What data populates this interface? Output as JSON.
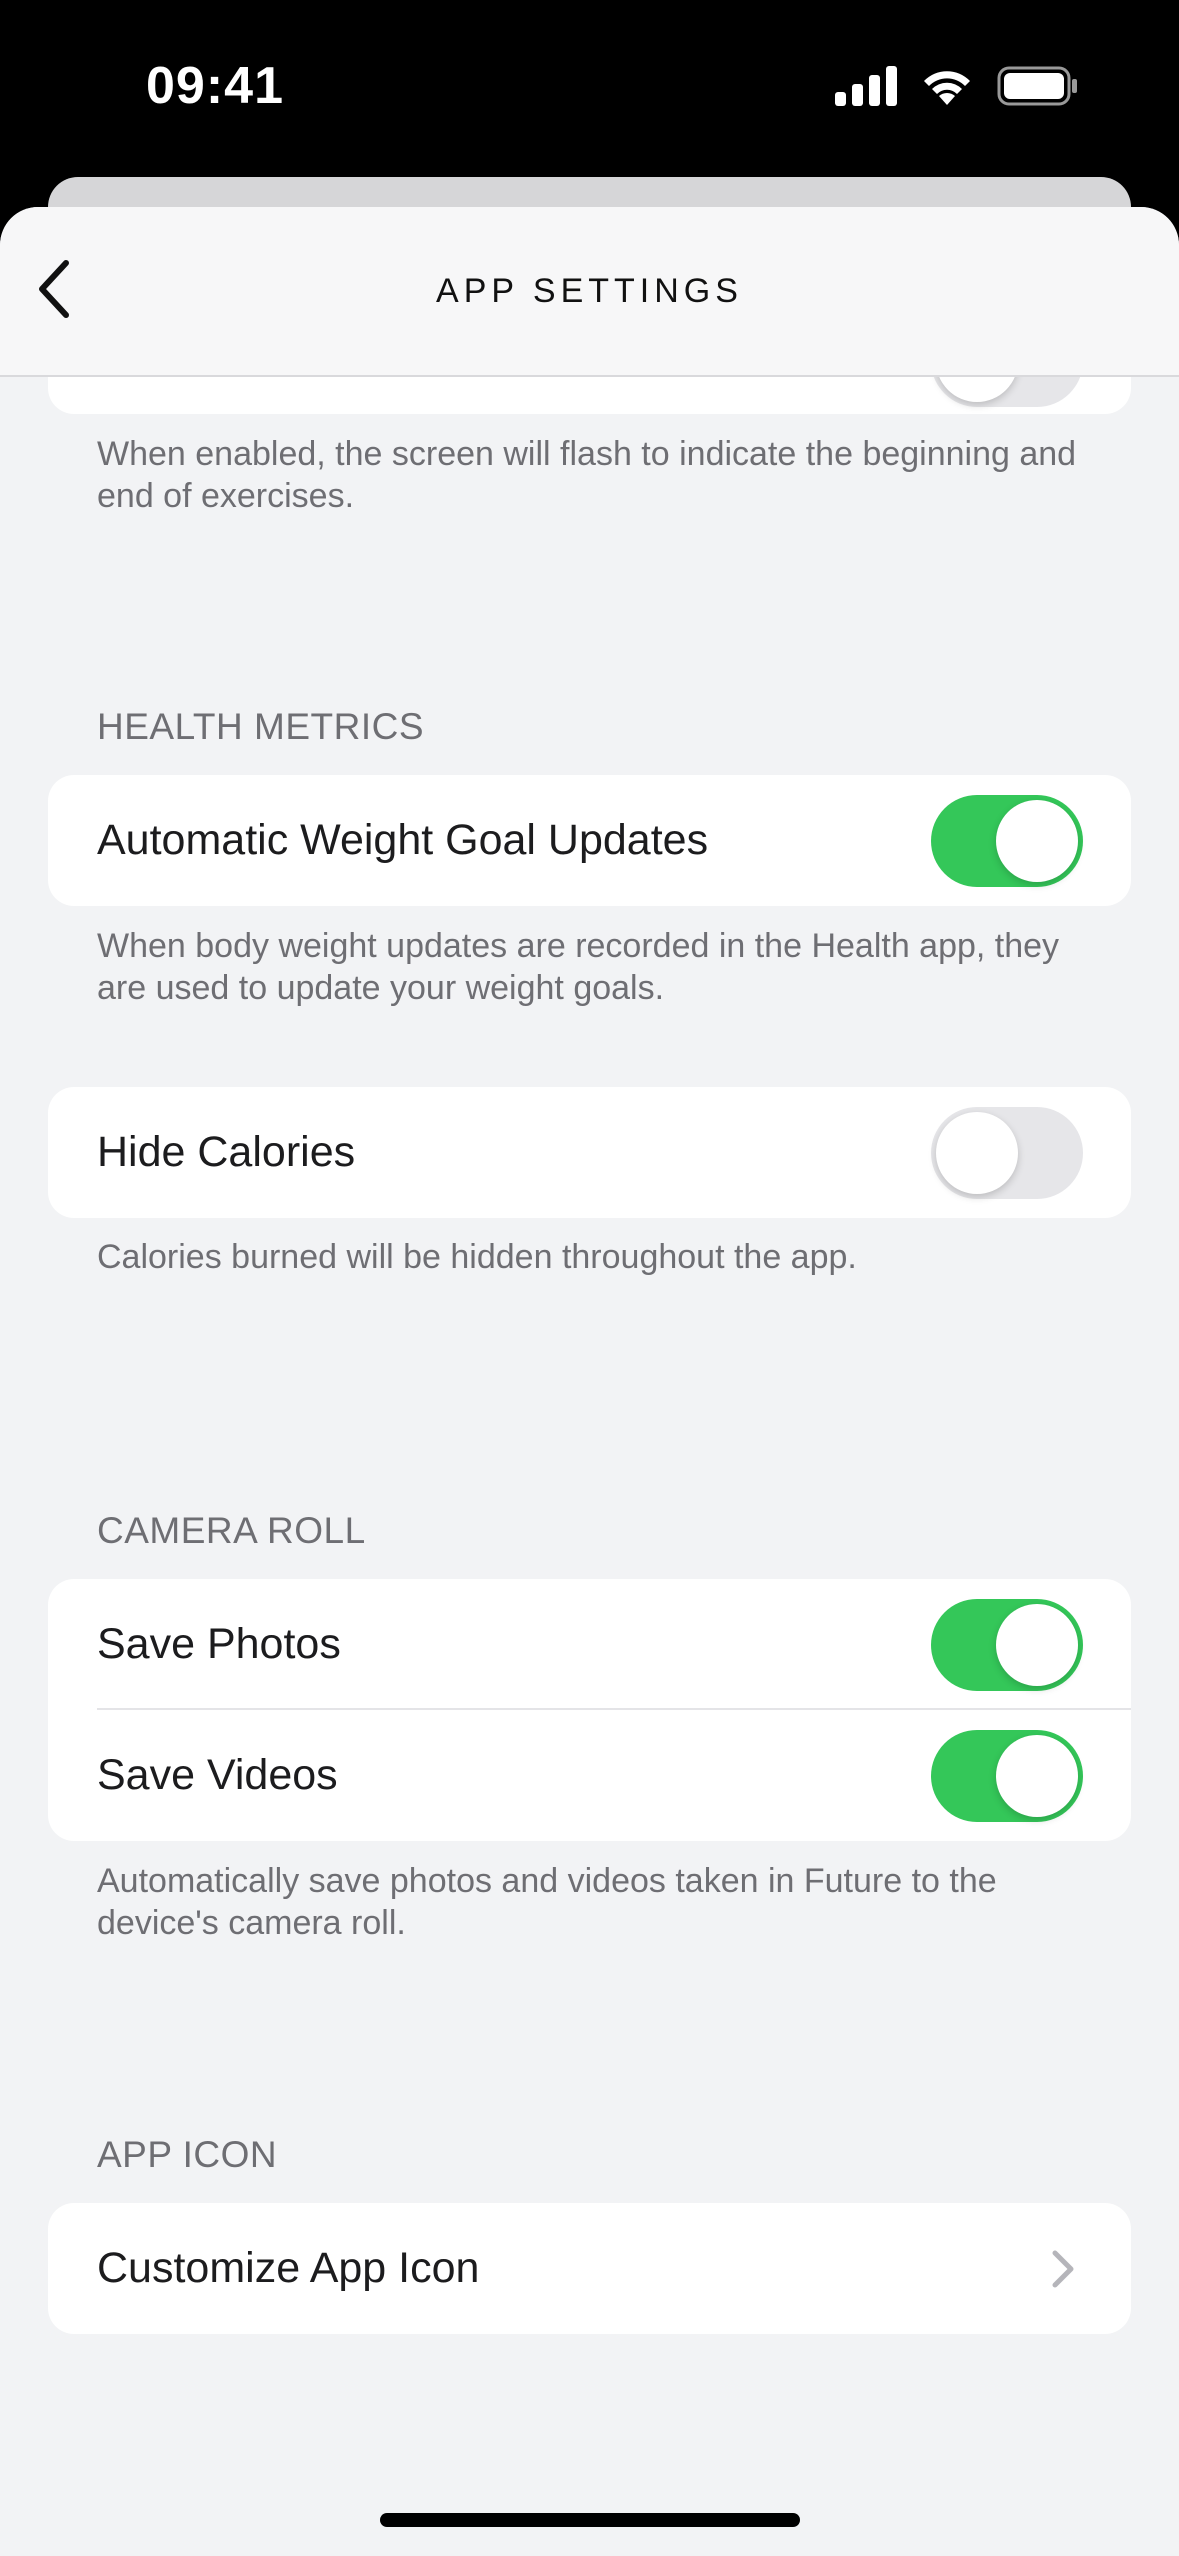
{
  "status_bar": {
    "time": "09:41"
  },
  "nav": {
    "title": "APP SETTINGS"
  },
  "sections": {
    "flash": {
      "footnote": "When enabled, the screen will flash to indicate the beginning and end of exercises."
    },
    "health_metrics": {
      "header": "HEALTH METRICS",
      "auto_weight": {
        "label": "Automatic Weight Goal Updates",
        "enabled": true
      },
      "auto_weight_footnote": "When body weight updates are recorded in the Health app, they are used to update your weight goals.",
      "hide_calories": {
        "label": "Hide Calories",
        "enabled": false
      },
      "hide_calories_footnote": "Calories burned will be hidden throughout the app."
    },
    "camera_roll": {
      "header": "CAMERA ROLL",
      "save_photos": {
        "label": "Save Photos",
        "enabled": true
      },
      "save_videos": {
        "label": "Save Videos",
        "enabled": true
      },
      "footnote": "Automatically save photos and videos taken in Future to the device's camera roll."
    },
    "app_icon": {
      "header": "APP ICON",
      "customize": {
        "label": "Customize App Icon"
      }
    }
  },
  "colors": {
    "toggle_on": "#34c759",
    "toggle_off": "#e6e6e9",
    "background": "#f2f3f5"
  }
}
